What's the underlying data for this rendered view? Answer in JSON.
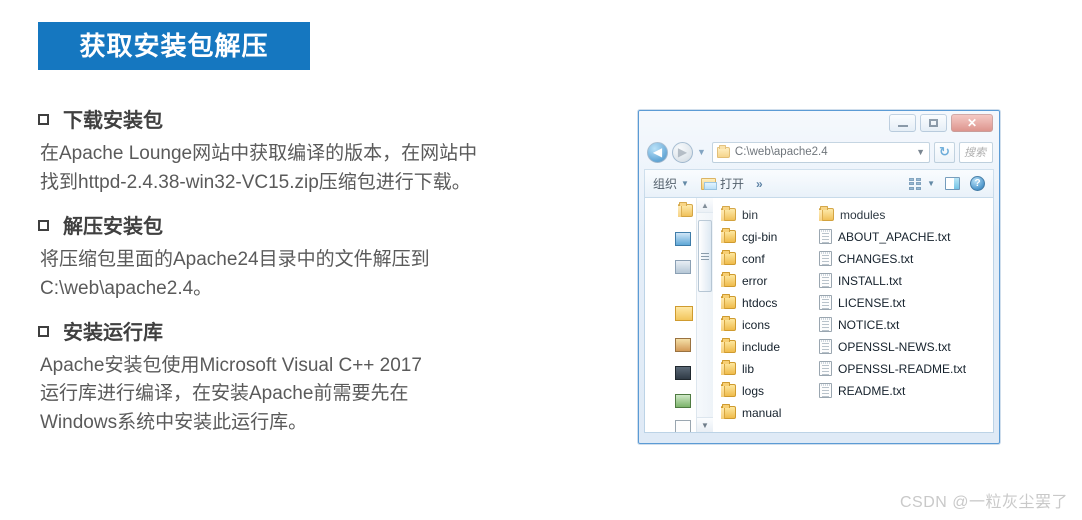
{
  "slide": {
    "title": "获取安装包解压",
    "banner_color": "#1577c0",
    "watermark": "CSDN @一粒灰尘罢了"
  },
  "sections": [
    {
      "heading": "下载安装包",
      "lines": [
        "在Apache Lounge网站中获取编译的版本，在网站中",
        "找到httpd-2.4.38-win32-VC15.zip压缩包进行下载。"
      ]
    },
    {
      "heading": "解压安装包",
      "lines": [
        "将压缩包里面的Apache24目录中的文件解压到",
        "C:\\web\\apache2.4。"
      ]
    },
    {
      "heading": "安装运行库",
      "lines": [
        "Apache安装包使用Microsoft Visual C++ 2017",
        "运行库进行编译，在安装Apache前需要先在",
        "Windows系统中安装此运行库。"
      ]
    }
  ],
  "explorer": {
    "window_controls": {
      "minimize": "–",
      "maximize": "□",
      "close": "✕"
    },
    "navigation": {
      "back_label": "◀",
      "forward_label": "▶",
      "history_caret": "▼"
    },
    "address": {
      "path": "C:\\web\\apache2.4",
      "dropdown_caret": "▼"
    },
    "refresh_label": "↻",
    "search": {
      "placeholder": "搜索"
    },
    "toolbar": {
      "organize_label": "组织",
      "organize_caret": "▼",
      "open_label": "打开",
      "overflow_label": "»",
      "view_caret": "▼",
      "help_label": "?"
    },
    "nav_pane": {
      "scroll_up": "▲",
      "scroll_down": "▼"
    },
    "file_columns": [
      {
        "items": [
          {
            "name": "bin",
            "type": "folder"
          },
          {
            "name": "cgi-bin",
            "type": "folder"
          },
          {
            "name": "conf",
            "type": "folder"
          },
          {
            "name": "error",
            "type": "folder"
          },
          {
            "name": "htdocs",
            "type": "folder"
          },
          {
            "name": "icons",
            "type": "folder"
          },
          {
            "name": "include",
            "type": "folder"
          },
          {
            "name": "lib",
            "type": "folder"
          },
          {
            "name": "logs",
            "type": "folder"
          },
          {
            "name": "manual",
            "type": "folder"
          }
        ]
      },
      {
        "items": [
          {
            "name": "modules",
            "type": "folder"
          },
          {
            "name": "ABOUT_APACHE.txt",
            "type": "txt"
          },
          {
            "name": "CHANGES.txt",
            "type": "txt"
          },
          {
            "name": "INSTALL.txt",
            "type": "txt"
          },
          {
            "name": "LICENSE.txt",
            "type": "txt"
          },
          {
            "name": "NOTICE.txt",
            "type": "txt"
          },
          {
            "name": "OPENSSL-NEWS.txt",
            "type": "txt"
          },
          {
            "name": "OPENSSL-README.txt",
            "type": "txt"
          },
          {
            "name": "README.txt",
            "type": "txt"
          }
        ]
      }
    ]
  }
}
